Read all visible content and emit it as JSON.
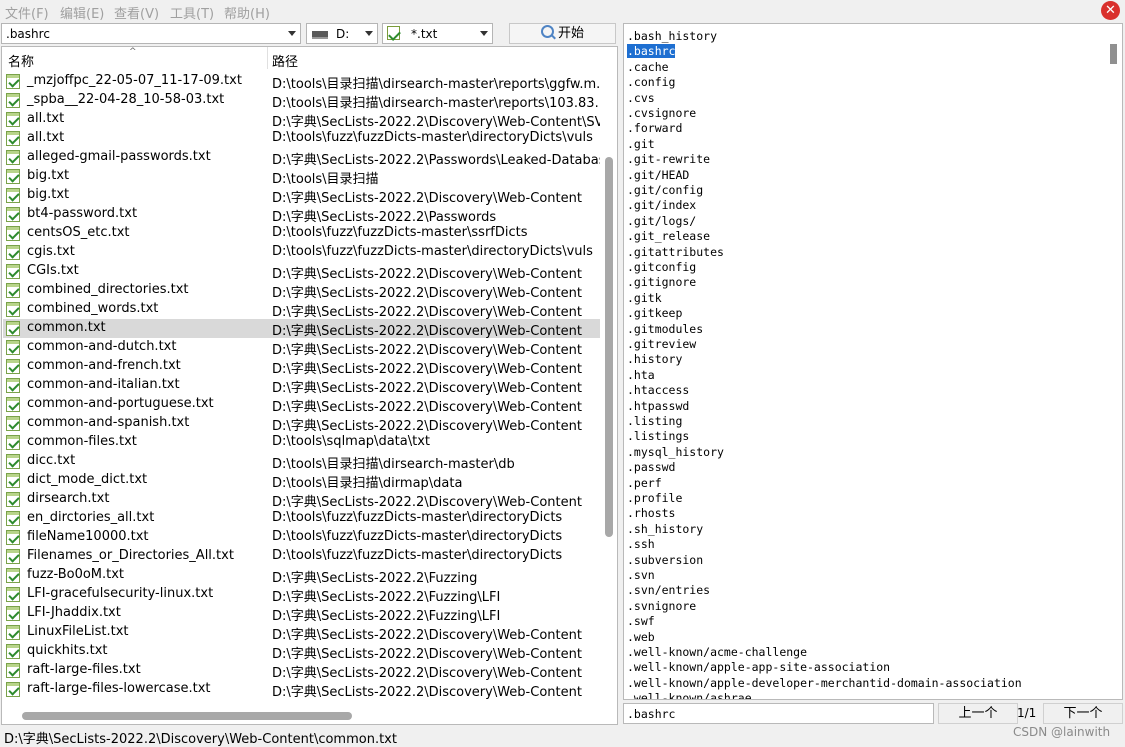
{
  "menu": [
    "文件(F)",
    "编辑(E)",
    "查看(V)",
    "工具(T)",
    "帮助(H)"
  ],
  "toolbar": {
    "search_value": ".bashrc",
    "drive_value": "D:",
    "filter_value": "*.txt",
    "start_label": "开始"
  },
  "columns": {
    "name": "名称",
    "path": "路径"
  },
  "files": [
    {
      "name": "_mzjoffpc_22-05-07_11-17-09.txt",
      "path": "D:\\tools\\目录扫描\\dirsearch-master\\reports\\ggfw.m..."
    },
    {
      "name": "_spba__22-04-28_10-58-03.txt",
      "path": "D:\\tools\\目录扫描\\dirsearch-master\\reports\\103.83..."
    },
    {
      "name": "all.txt",
      "path": "D:\\字典\\SecLists-2022.2\\Discovery\\Web-Content\\SV..."
    },
    {
      "name": "all.txt",
      "path": "D:\\tools\\fuzz\\fuzzDicts-master\\directoryDicts\\vuls"
    },
    {
      "name": "alleged-gmail-passwords.txt",
      "path": "D:\\字典\\SecLists-2022.2\\Passwords\\Leaked-Database..."
    },
    {
      "name": "big.txt",
      "path": "D:\\tools\\目录扫描"
    },
    {
      "name": "big.txt",
      "path": "D:\\字典\\SecLists-2022.2\\Discovery\\Web-Content"
    },
    {
      "name": "bt4-password.txt",
      "path": "D:\\字典\\SecLists-2022.2\\Passwords"
    },
    {
      "name": "centsOS_etc.txt",
      "path": "D:\\tools\\fuzz\\fuzzDicts-master\\ssrfDicts"
    },
    {
      "name": "cgis.txt",
      "path": "D:\\tools\\fuzz\\fuzzDicts-master\\directoryDicts\\vuls"
    },
    {
      "name": "CGIs.txt",
      "path": "D:\\字典\\SecLists-2022.2\\Discovery\\Web-Content"
    },
    {
      "name": "combined_directories.txt",
      "path": "D:\\字典\\SecLists-2022.2\\Discovery\\Web-Content"
    },
    {
      "name": "combined_words.txt",
      "path": "D:\\字典\\SecLists-2022.2\\Discovery\\Web-Content"
    },
    {
      "name": "common.txt",
      "path": "D:\\字典\\SecLists-2022.2\\Discovery\\Web-Content"
    },
    {
      "name": "common-and-dutch.txt",
      "path": "D:\\字典\\SecLists-2022.2\\Discovery\\Web-Content"
    },
    {
      "name": "common-and-french.txt",
      "path": "D:\\字典\\SecLists-2022.2\\Discovery\\Web-Content"
    },
    {
      "name": "common-and-italian.txt",
      "path": "D:\\字典\\SecLists-2022.2\\Discovery\\Web-Content"
    },
    {
      "name": "common-and-portuguese.txt",
      "path": "D:\\字典\\SecLists-2022.2\\Discovery\\Web-Content"
    },
    {
      "name": "common-and-spanish.txt",
      "path": "D:\\字典\\SecLists-2022.2\\Discovery\\Web-Content"
    },
    {
      "name": "common-files.txt",
      "path": "D:\\tools\\sqlmap\\data\\txt"
    },
    {
      "name": "dicc.txt",
      "path": "D:\\tools\\目录扫描\\dirsearch-master\\db"
    },
    {
      "name": "dict_mode_dict.txt",
      "path": "D:\\tools\\目录扫描\\dirmap\\data"
    },
    {
      "name": "dirsearch.txt",
      "path": "D:\\字典\\SecLists-2022.2\\Discovery\\Web-Content"
    },
    {
      "name": "en_dirctories_all.txt",
      "path": "D:\\tools\\fuzz\\fuzzDicts-master\\directoryDicts"
    },
    {
      "name": "fileName10000.txt",
      "path": "D:\\tools\\fuzz\\fuzzDicts-master\\directoryDicts"
    },
    {
      "name": "Filenames_or_Directories_All.txt",
      "path": "D:\\tools\\fuzz\\fuzzDicts-master\\directoryDicts"
    },
    {
      "name": "fuzz-Bo0oM.txt",
      "path": "D:\\字典\\SecLists-2022.2\\Fuzzing"
    },
    {
      "name": "LFI-gracefulsecurity-linux.txt",
      "path": "D:\\字典\\SecLists-2022.2\\Fuzzing\\LFI"
    },
    {
      "name": "LFI-Jhaddix.txt",
      "path": "D:\\字典\\SecLists-2022.2\\Fuzzing\\LFI"
    },
    {
      "name": "LinuxFileList.txt",
      "path": "D:\\字典\\SecLists-2022.2\\Discovery\\Web-Content"
    },
    {
      "name": "quickhits.txt",
      "path": "D:\\字典\\SecLists-2022.2\\Discovery\\Web-Content"
    },
    {
      "name": "raft-large-files.txt",
      "path": "D:\\字典\\SecLists-2022.2\\Discovery\\Web-Content"
    },
    {
      "name": "raft-large-files-lowercase.txt",
      "path": "D:\\字典\\SecLists-2022.2\\Discovery\\Web-Content"
    }
  ],
  "selected_index": 13,
  "content_lines": [
    ".bash_history",
    ".bashrc",
    ".cache",
    ".config",
    ".cvs",
    ".cvsignore",
    ".forward",
    ".git",
    ".git-rewrite",
    ".git/HEAD",
    ".git/config",
    ".git/index",
    ".git/logs/",
    ".git_release",
    ".gitattributes",
    ".gitconfig",
    ".gitignore",
    ".gitk",
    ".gitkeep",
    ".gitmodules",
    ".gitreview",
    ".history",
    ".hta",
    ".htaccess",
    ".htpasswd",
    ".listing",
    ".listings",
    ".mysql_history",
    ".passwd",
    ".perf",
    ".profile",
    ".rhosts",
    ".sh_history",
    ".ssh",
    ".subversion",
    ".svn",
    ".svn/entries",
    ".svnignore",
    ".swf",
    ".web",
    ".well-known/acme-challenge",
    ".well-known/apple-app-site-association",
    ".well-known/apple-developer-merchantid-domain-association",
    ".well-known/ashrae"
  ],
  "highlight_index": 1,
  "find": {
    "value": ".bashrc",
    "prev_label": "上一个",
    "counter": "1/1",
    "next_label": "下一个"
  },
  "status_path": "D:\\字典\\SecLists-2022.2\\Discovery\\Web-Content\\common.txt",
  "watermark": "CSDN @lainwith",
  "colors": {
    "highlight": "#1e6fd1",
    "selected_row": "#d9d9d9",
    "close": "#d9302c"
  }
}
